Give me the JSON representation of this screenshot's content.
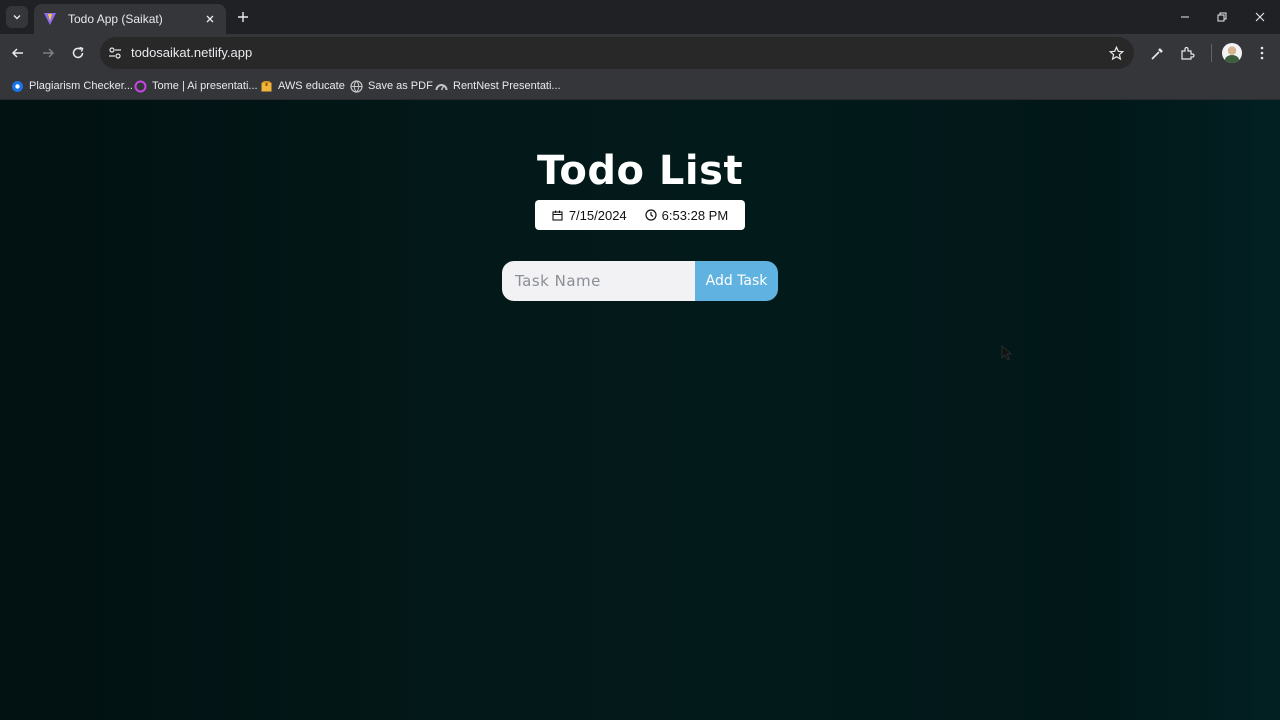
{
  "browser": {
    "tab": {
      "title": "Todo App (Saikat)"
    },
    "address_bar": {
      "url": "todosaikat.netlify.app"
    },
    "bookmarks": [
      {
        "label": "Plagiarism Checker...",
        "icon": "globe-blue-icon"
      },
      {
        "label": "Tome | Ai presentati...",
        "icon": "tome-icon"
      },
      {
        "label": "AWS educate",
        "icon": "package-icon"
      },
      {
        "label": "Save as PDF",
        "icon": "globe-icon"
      },
      {
        "label": "RentNest Presentati...",
        "icon": "gauge-icon"
      }
    ]
  },
  "app": {
    "title": "Todo List",
    "date": "7/15/2024",
    "time": "6:53:28 PM",
    "task_input_placeholder": "Task Name",
    "add_button_label": "Add Task"
  },
  "colors": {
    "accent_button": "#60b3e1",
    "page_background": "#031818"
  }
}
